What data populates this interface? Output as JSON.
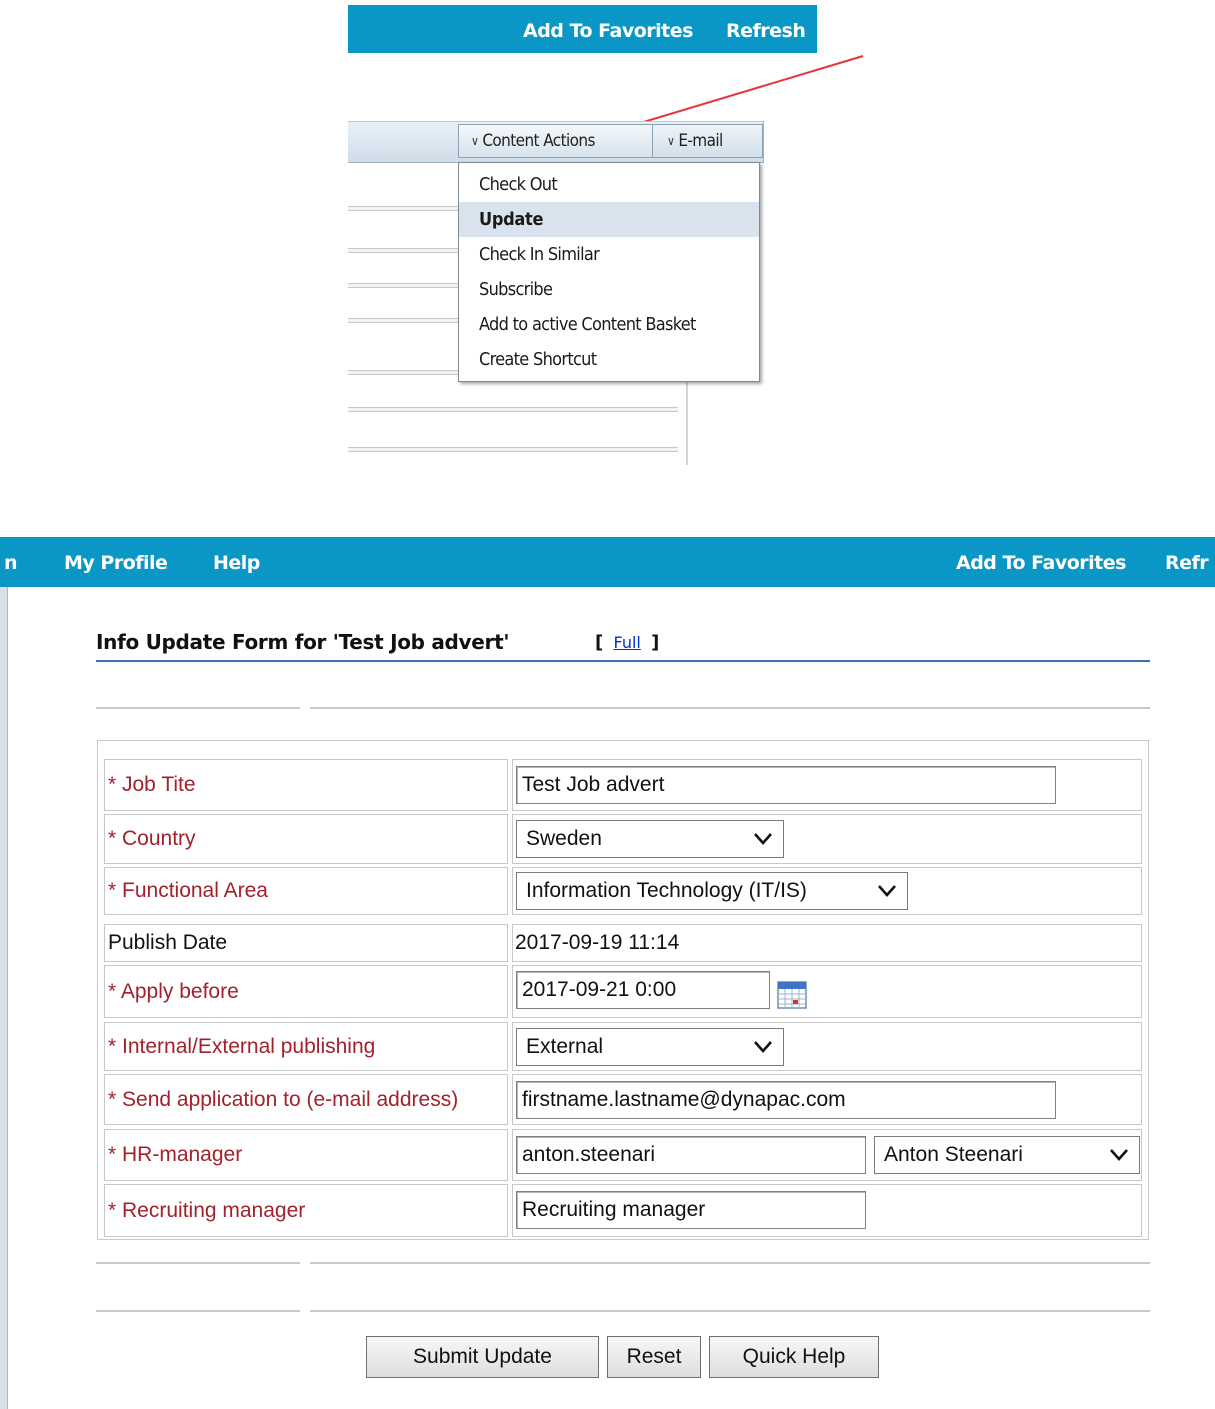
{
  "snippet": {
    "topbar": {
      "add_to_favorites": "Add To Favorites",
      "refresh": "Refresh"
    },
    "toolbar": {
      "content_actions": "Content Actions",
      "email": "E-mail"
    },
    "menu": {
      "items": [
        "Check Out",
        "Update",
        "Check In Similar",
        "Subscribe",
        "Add to active Content Basket",
        "Create Shortcut"
      ],
      "active_item": "Update"
    },
    "arrow_color": "#e8323c"
  },
  "nav": {
    "partial_left": "n",
    "my_profile": "My Profile",
    "help": "Help",
    "add_to_favorites": "Add To Favorites",
    "refresh_partial": "Refr"
  },
  "form": {
    "title": "Info Update Form for 'Test Job advert'",
    "bracket_open": "[",
    "full_link": "Full",
    "bracket_close": "]",
    "fields": {
      "job_title": {
        "label": "* Job Tite",
        "value": "Test Job advert"
      },
      "country": {
        "label": "* Country",
        "value": "Sweden"
      },
      "functional_area": {
        "label": "* Functional Area",
        "value": "Information Technology (IT/IS)"
      },
      "publish_date": {
        "label": "Publish Date",
        "value": "2017-09-19 11:14"
      },
      "apply_before": {
        "label": "* Apply before",
        "value": "2017-09-21 0:00"
      },
      "publishing": {
        "label": "* Internal/External publishing",
        "value": "External"
      },
      "send_application": {
        "label": "* Send application to (e-mail address)",
        "value": "firstname.lastname@dynapac.com"
      },
      "hr_manager": {
        "label": "* HR-manager",
        "value": "anton.steenari",
        "select_value": "Anton Steenari"
      },
      "recruiting_manager": {
        "label": "* Recruiting manager",
        "value": "Recruiting manager"
      }
    },
    "buttons": {
      "submit": "Submit Update",
      "reset": "Reset",
      "quick_help": "Quick Help"
    }
  },
  "colors": {
    "brand_bar": "#0b97c6",
    "required_label": "#a3212b",
    "link": "#0033cc",
    "title_rule": "#3d6db5"
  }
}
